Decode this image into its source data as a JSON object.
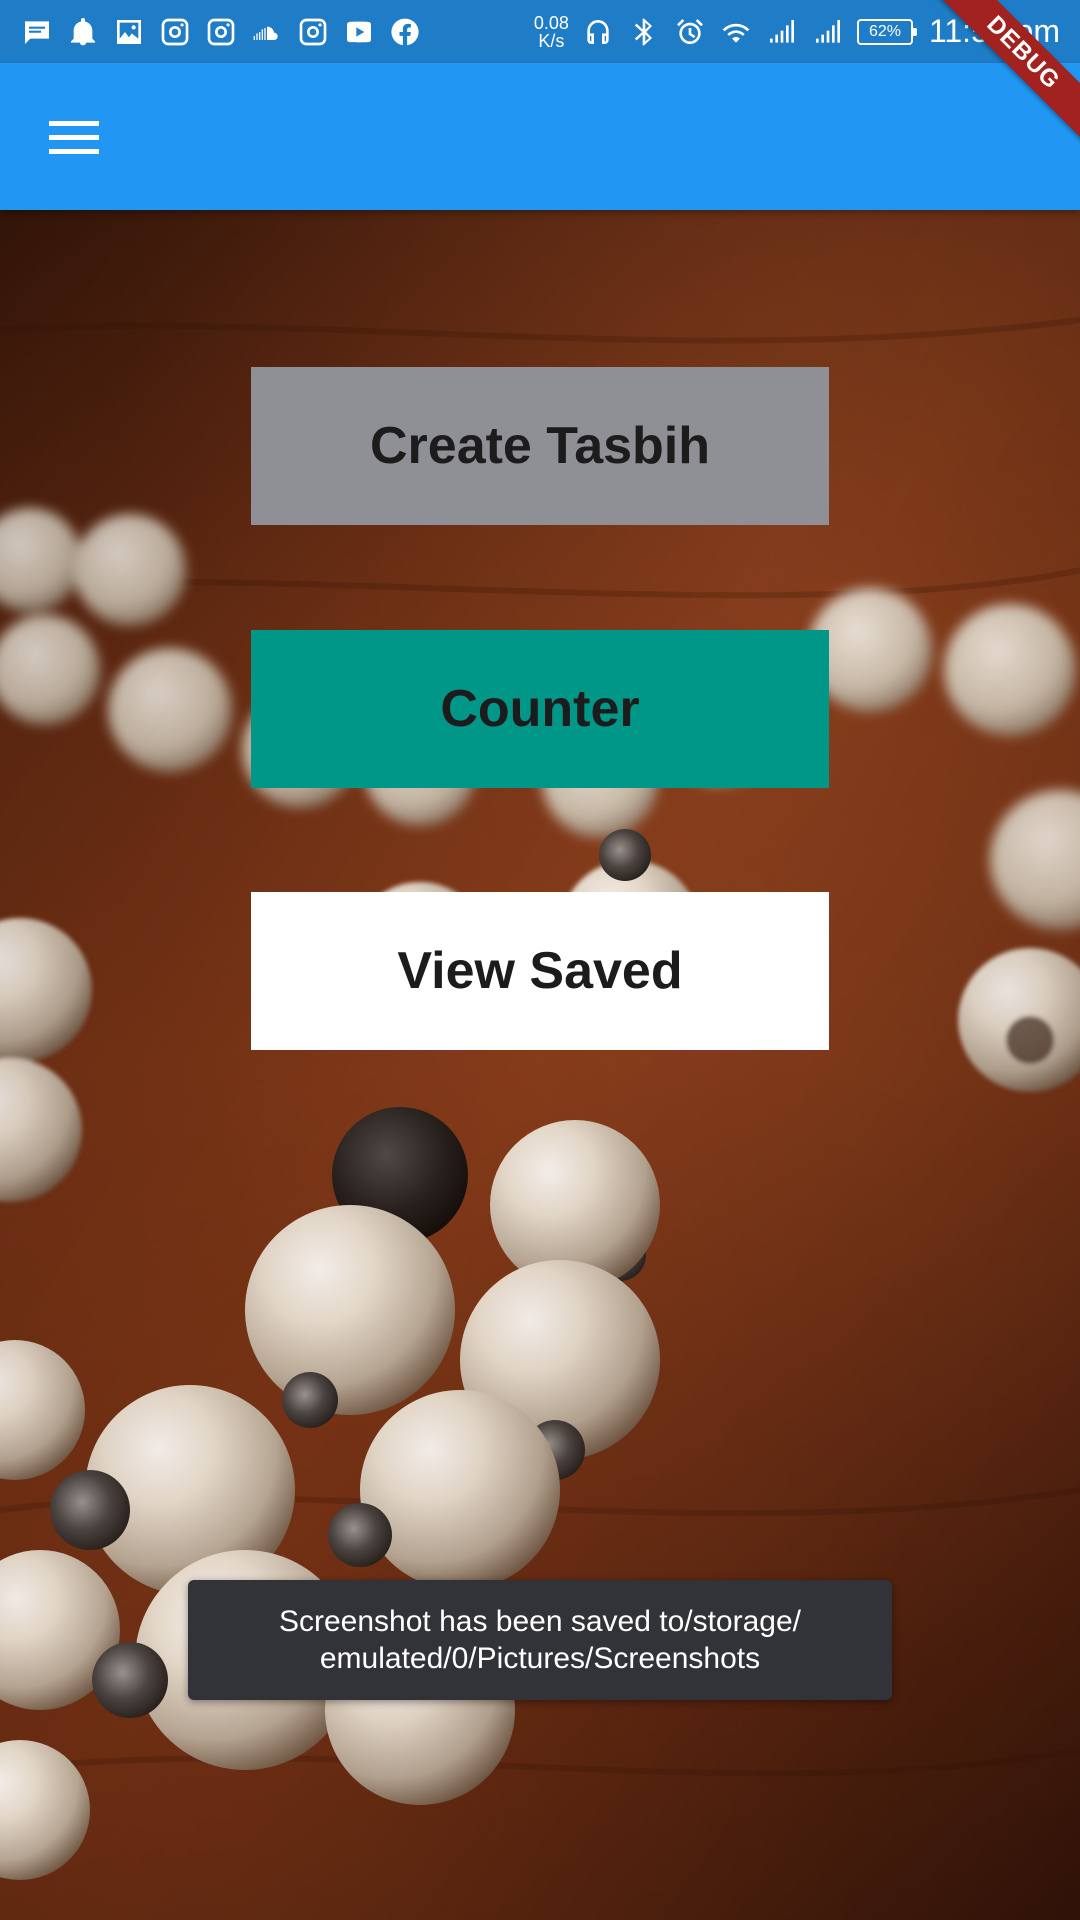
{
  "status_bar": {
    "icons_left": [
      "message-icon",
      "notification-bell-icon",
      "gallery-icon",
      "instagram-icon",
      "instagram-icon",
      "soundcloud-icon",
      "instagram-icon",
      "youtube-icon",
      "facebook-icon"
    ],
    "net_speed_value": "0.08",
    "net_speed_unit": "K/s",
    "icons_right": [
      "headphones-icon",
      "bluetooth-icon",
      "alarm-icon",
      "wifi-icon",
      "signal-icon",
      "signal-icon"
    ],
    "battery": "62%",
    "time": "11:51 pm"
  },
  "debug_banner": "DEBUG",
  "app_bar": {
    "menu_icon": "hamburger-menu-icon",
    "color": "#2196f3"
  },
  "buttons": {
    "create_tasbih": "Create Tasbih",
    "counter": "Counter",
    "view_saved": "View Saved"
  },
  "toast": {
    "line1": "Screenshot has been saved to/storage/",
    "line2": "emulated/0/Pictures/Screenshots"
  },
  "colors": {
    "status_bar": "#1f7cc6",
    "app_bar": "#2196f3",
    "create_button": "#8f8f96",
    "counter_button": "#009688",
    "view_saved_button": "#ffffff",
    "toast_bg": "#323338",
    "debug_banner": "#a2221f"
  }
}
